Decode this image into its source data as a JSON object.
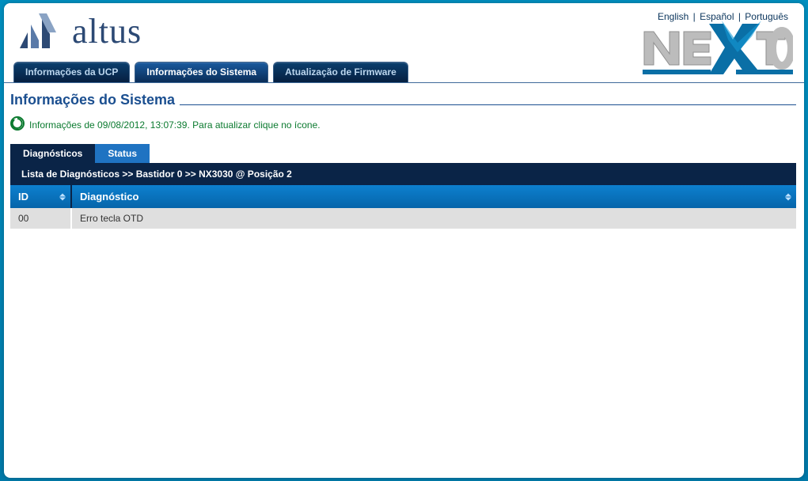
{
  "lang_links": {
    "en": "English",
    "es": "Español",
    "pt": "Português"
  },
  "brand": {
    "name": "altus"
  },
  "main_tabs": {
    "ucp": "Informações da UCP",
    "system": "Informações do Sistema",
    "firmware": "Atualização de Firmware"
  },
  "page": {
    "title": "Informações do Sistema",
    "refresh_msg": "Informações de 09/08/2012, 13:07:39. Para atualizar clique no ícone."
  },
  "sub_tabs": {
    "diag": "Diagnósticos",
    "status": "Status"
  },
  "breadcrumb": "Lista de Diagnósticos >> Bastidor 0 >> NX3030 @ Posição 2",
  "table": {
    "cols": {
      "id": "ID",
      "diag": "Diagnóstico"
    },
    "rows": [
      {
        "id": "00",
        "diag": "Erro tecla OTD"
      }
    ]
  }
}
